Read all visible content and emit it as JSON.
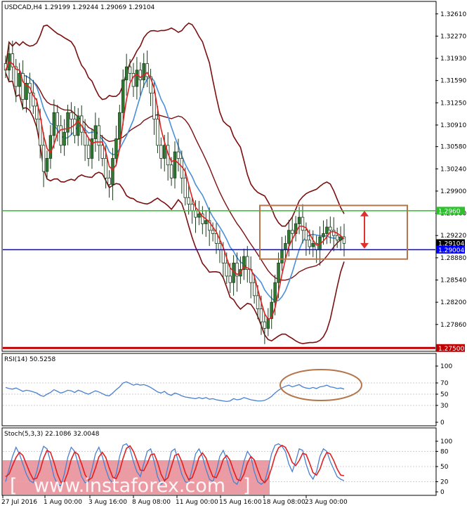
{
  "chart_data": {
    "type": "candlestick",
    "symbol_line": "USDCAD,H4  1.29199 1.29244 1.29069 1.29104",
    "price_ticks": [
      "1.32610",
      "1.32270",
      "1.31930",
      "1.31590",
      "1.31250",
      "1.30910",
      "1.30580",
      "1.30240",
      "1.29900",
      "1.29560",
      "1.29220",
      "1.28880",
      "1.28540",
      "1.28200",
      "1.27860"
    ],
    "y_range": [
      1.2746,
      1.3279
    ],
    "x_ticks": [
      "27 Jul 2016",
      "1 Aug 00:00",
      "3 Aug 16:00",
      "8 Aug 08:00",
      "11 Aug 00:00",
      "15 Aug 16:00",
      "18 Aug 08:00",
      "23 Aug 00:00"
    ],
    "levels": [
      {
        "name": "resistance",
        "value": 1.296,
        "label": "1.2960",
        "color": "#2fbf2f"
      },
      {
        "name": "current-price",
        "value": 1.29104,
        "label": "1.29104",
        "color": "#000000"
      },
      {
        "name": "support",
        "value": 1.29004,
        "label": "1.29004",
        "color": "#0000ff"
      },
      {
        "name": "major-support",
        "value": 1.275,
        "label": "1.27500",
        "color": "#c00000"
      }
    ],
    "indicators": [
      "Bollinger Bands",
      "Moving Average (red)",
      "Moving Average (blue)"
    ],
    "closes": [
      1.3175,
      1.32,
      1.318,
      1.315,
      1.317,
      1.313,
      1.3155,
      1.314,
      1.312,
      1.31,
      1.306,
      1.302,
      1.304,
      1.3075,
      1.311,
      1.309,
      1.306,
      1.308,
      1.311,
      1.31,
      1.3075,
      1.3105,
      1.308,
      1.306,
      1.304,
      1.307,
      1.309,
      1.306,
      1.304,
      1.301,
      1.3,
      1.304,
      1.307,
      1.311,
      1.316,
      1.318,
      1.317,
      1.315,
      1.3175,
      1.316,
      1.3185,
      1.3165,
      1.314,
      1.31,
      1.306,
      1.304,
      1.306,
      1.303,
      1.301,
      1.305,
      1.304,
      1.301,
      1.298,
      1.297,
      1.296,
      1.295,
      1.2955,
      1.294,
      1.2945,
      1.293,
      1.2925,
      1.291,
      1.29,
      1.288,
      1.286,
      1.285,
      1.288,
      1.286,
      1.287,
      1.289,
      1.287,
      1.285,
      1.283,
      1.281,
      1.279,
      1.278,
      1.2795,
      1.282,
      1.285,
      1.288,
      1.29,
      1.291,
      1.293,
      1.2925,
      1.294,
      1.295,
      1.293,
      1.2915,
      1.2905,
      1.291,
      1.29,
      1.292,
      1.2925,
      1.2935,
      1.293,
      1.2922,
      1.2915,
      1.292,
      1.291
    ],
    "rsi": {
      "label": "RSI(14) 50.5258",
      "levels": [
        100,
        70,
        50,
        30,
        0
      ],
      "range": [
        0,
        100
      ],
      "values": [
        62,
        60,
        59,
        61,
        58,
        55,
        57,
        56,
        54,
        52,
        48,
        46,
        50,
        53,
        58,
        55,
        52,
        54,
        57,
        56,
        53,
        57,
        55,
        52,
        50,
        53,
        56,
        54,
        51,
        48,
        47,
        52,
        58,
        63,
        70,
        72,
        69,
        66,
        68,
        66,
        67,
        65,
        62,
        58,
        54,
        52,
        55,
        50,
        48,
        52,
        50,
        47,
        45,
        44,
        43,
        42,
        44,
        42,
        44,
        41,
        42,
        40,
        39,
        38,
        37,
        38,
        42,
        40,
        41,
        44,
        42,
        40,
        39,
        38,
        38,
        39,
        42,
        46,
        52,
        57,
        61,
        64,
        66,
        63,
        65,
        67,
        63,
        61,
        60,
        62,
        60,
        63,
        64,
        66,
        63,
        62,
        60,
        61,
        59
      ]
    },
    "stoch": {
      "label": "Stoch(5,3,3) 22.1086 32.0048",
      "levels": [
        100,
        80,
        50,
        20,
        0
      ],
      "range": [
        0,
        100
      ],
      "k": [
        20,
        45,
        70,
        88,
        75,
        55,
        35,
        22,
        18,
        40,
        70,
        90,
        85,
        60,
        30,
        15,
        12,
        35,
        68,
        88,
        80,
        55,
        30,
        18,
        20,
        45,
        75,
        88,
        70,
        45,
        25,
        18,
        35,
        70,
        92,
        95,
        85,
        60,
        40,
        30,
        55,
        80,
        85,
        60,
        30,
        15,
        20,
        50,
        80,
        85,
        60,
        35,
        20,
        18,
        45,
        75,
        85,
        70,
        45,
        25,
        20,
        40,
        70,
        82,
        65,
        40,
        20,
        15,
        30,
        60,
        80,
        70,
        40,
        20,
        15,
        20,
        45,
        75,
        92,
        95,
        90,
        80,
        55,
        40,
        60,
        85,
        82,
        55,
        35,
        25,
        40,
        70,
        85,
        80,
        60,
        45,
        30,
        25,
        22
      ],
      "d": [
        30,
        35,
        52,
        68,
        78,
        72,
        55,
        38,
        25,
        27,
        43,
        67,
        82,
        78,
        58,
        35,
        19,
        20,
        38,
        64,
        79,
        74,
        55,
        34,
        23,
        28,
        47,
        69,
        78,
        68,
        47,
        29,
        26,
        41,
        66,
        86,
        91,
        80,
        62,
        43,
        42,
        56,
        73,
        75,
        58,
        35,
        22,
        28,
        50,
        72,
        75,
        60,
        38,
        24,
        28,
        46,
        68,
        77,
        67,
        47,
        30,
        28,
        43,
        64,
        72,
        62,
        42,
        25,
        22,
        35,
        57,
        70,
        63,
        43,
        25,
        18,
        27,
        47,
        71,
        87,
        92,
        88,
        75,
        58,
        52,
        62,
        76,
        74,
        57,
        38,
        33,
        45,
        65,
        78,
        75,
        62,
        45,
        33,
        32
      ]
    },
    "annotations": [
      {
        "name": "range-box",
        "type": "rectangle",
        "color": "#b5754a"
      },
      {
        "name": "range-arrow",
        "type": "double-arrow",
        "color": "#e03030"
      },
      {
        "name": "rsi-ellipse",
        "type": "ellipse",
        "color": "#b5754a"
      }
    ]
  },
  "watermark": "www.instaforex.com"
}
